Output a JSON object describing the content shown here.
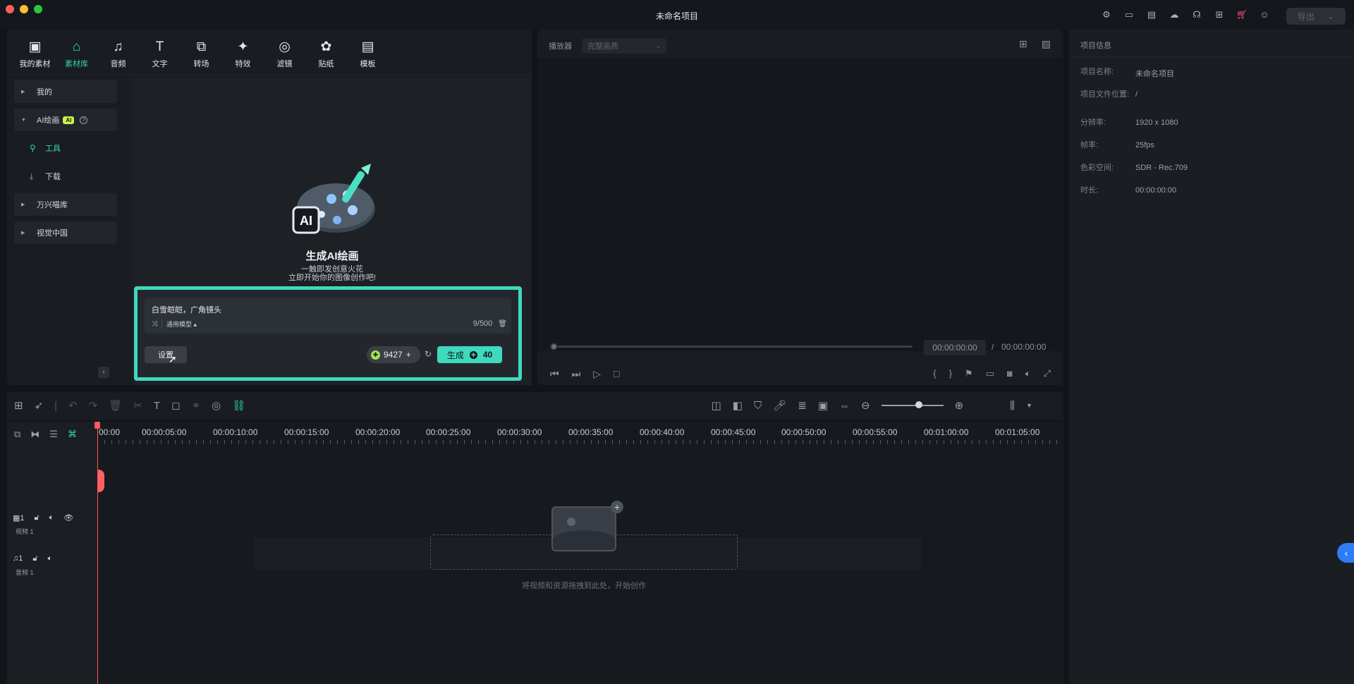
{
  "window": {
    "title": "未命名项目",
    "export_label": "导出"
  },
  "titlebar_icons": [
    "project-settings-icon",
    "layout-icon",
    "save-icon",
    "cloud-upload-icon",
    "support-icon",
    "apps-grid-icon",
    "cart-icon",
    "account-icon"
  ],
  "media": {
    "tabs": [
      {
        "label": "我的素材",
        "icon": "my-media-icon",
        "glyph": "▣"
      },
      {
        "label": "素材库",
        "icon": "stock-media-icon",
        "glyph": "⌂"
      },
      {
        "label": "音频",
        "icon": "music-note-icon",
        "glyph": "♫"
      },
      {
        "label": "文字",
        "icon": "text-icon",
        "glyph": "T"
      },
      {
        "label": "转场",
        "icon": "transition-icon",
        "glyph": "⧉"
      },
      {
        "label": "特效",
        "icon": "effects-icon",
        "glyph": "✦"
      },
      {
        "label": "滤镜",
        "icon": "filter-icon",
        "glyph": "◎"
      },
      {
        "label": "贴纸",
        "icon": "sticker-icon",
        "glyph": "✿"
      },
      {
        "label": "模板",
        "icon": "template-icon",
        "glyph": "▤"
      }
    ],
    "active_tab": "素材库",
    "sidebar": {
      "mine": "我的",
      "ai_paint": "AI绘画",
      "ai_badge": "AI",
      "tools": "工具",
      "download": "下载",
      "wondershare": "万兴喵库",
      "vcg": "视觉中国"
    },
    "hero": {
      "title": "生成AI绘画",
      "sub1": "一触即发创意火花",
      "sub2": "立即开始你的图像创作吧!"
    },
    "prompt": {
      "text": "白雪皑皑，广角镜头",
      "model": "通用模型",
      "count": "9/500",
      "settings_label": "设置",
      "credits": "9427",
      "generate_label": "生成",
      "generate_cost": "40"
    }
  },
  "player": {
    "label": "播放器",
    "quality": "完整画质",
    "current_time": "00:00:00:00",
    "separator": "/",
    "total_time": "00:00:00:00"
  },
  "info": {
    "title": "项目信息",
    "rows": [
      {
        "k": "项目名称:",
        "v": "未命名项目"
      },
      {
        "k": "项目文件位置:",
        "v": "/"
      },
      {
        "k": "分辨率:",
        "v": "1920 x 1080"
      },
      {
        "k": "帧率:",
        "v": "25fps"
      },
      {
        "k": "色彩空间:",
        "v": "SDR - Rec.709"
      },
      {
        "k": "时长:",
        "v": "00:00:00:00"
      }
    ]
  },
  "timeline": {
    "ruler": [
      "00:00",
      "00:00:05:00",
      "00:00:10:00",
      "00:00:15:00",
      "00:00:20:00",
      "00:00:25:00",
      "00:00:30:00",
      "00:00:35:00",
      "00:00:40:00",
      "00:00:45:00",
      "00:00:50:00",
      "00:00:55:00",
      "00:01:00:00",
      "00:01:05:00"
    ],
    "video_track": "视频 1",
    "video_num": "1",
    "audio_track": "音频 1",
    "audio_num": "1",
    "drop_hint": "将视频和资源拖拽到此处，开始创作"
  }
}
